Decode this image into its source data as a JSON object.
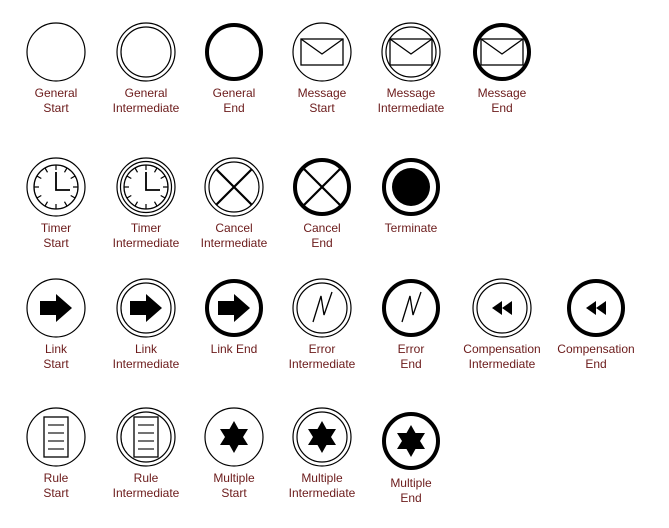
{
  "palette": {
    "stroke": "#000000",
    "label": "#6b1a1a",
    "background": "#ffffff"
  },
  "rows": [
    {
      "items": [
        {
          "id": "general-start",
          "icon": "general-start-event-icon",
          "lines": [
            "General",
            "Start"
          ]
        },
        {
          "id": "general-intermediate",
          "icon": "general-intermediate-event-icon",
          "lines": [
            "General",
            "Intermediate"
          ]
        },
        {
          "id": "general-end",
          "icon": "general-end-event-icon",
          "lines": [
            "General",
            "End"
          ]
        },
        {
          "id": "message-start",
          "icon": "message-start-event-icon",
          "lines": [
            "Message",
            "Start"
          ]
        },
        {
          "id": "message-intermediate",
          "icon": "message-intermediate-event-icon",
          "lines": [
            "Message",
            "Intermediate"
          ]
        },
        {
          "id": "message-end",
          "icon": "message-end-event-icon",
          "lines": [
            "Message",
            "End"
          ]
        }
      ]
    },
    {
      "items": [
        {
          "id": "timer-start",
          "icon": "timer-start-event-icon",
          "lines": [
            "Timer",
            "Start"
          ]
        },
        {
          "id": "timer-intermediate",
          "icon": "timer-intermediate-event-icon",
          "lines": [
            "Timer",
            "Intermediate"
          ]
        },
        {
          "id": "cancel-intermediate",
          "icon": "cancel-intermediate-event-icon",
          "lines": [
            "Cancel",
            "Intermediate"
          ]
        },
        {
          "id": "cancel-end",
          "icon": "cancel-end-event-icon",
          "lines": [
            "Cancel",
            "End"
          ]
        },
        {
          "id": "terminate",
          "icon": "terminate-event-icon",
          "lines": [
            "Terminate"
          ]
        }
      ]
    },
    {
      "items": [
        {
          "id": "link-start",
          "icon": "link-start-event-icon",
          "lines": [
            "Link",
            "Start"
          ]
        },
        {
          "id": "link-intermediate",
          "icon": "link-intermediate-event-icon",
          "lines": [
            "Link",
            "Intermediate"
          ]
        },
        {
          "id": "link-end",
          "icon": "link-end-event-icon",
          "lines": [
            "Link End"
          ]
        },
        {
          "id": "error-intermediate",
          "icon": "error-intermediate-event-icon",
          "lines": [
            "Error",
            "Intermediate"
          ]
        },
        {
          "id": "error-end",
          "icon": "error-end-event-icon",
          "lines": [
            "Error",
            "End"
          ]
        },
        {
          "id": "compensation-intermediate",
          "icon": "compensation-intermediate-event-icon",
          "lines": [
            "Compensation",
            "Intermediate"
          ]
        },
        {
          "id": "compensation-end",
          "icon": "compensation-end-event-icon",
          "lines": [
            "Compensation",
            "End"
          ]
        }
      ]
    },
    {
      "items": [
        {
          "id": "rule-start",
          "icon": "rule-start-event-icon",
          "lines": [
            "Rule",
            "Start"
          ]
        },
        {
          "id": "rule-intermediate",
          "icon": "rule-intermediate-event-icon",
          "lines": [
            "Rule",
            "Intermediate"
          ]
        },
        {
          "id": "multiple-start",
          "icon": "multiple-start-event-icon",
          "lines": [
            "Multiple",
            "Start"
          ]
        },
        {
          "id": "multiple-intermediate",
          "icon": "multiple-intermediate-event-icon",
          "lines": [
            "Multiple",
            "Intermediate"
          ]
        },
        {
          "id": "multiple-end",
          "icon": "multiple-end-event-icon",
          "lines": [
            "Multiple",
            "End"
          ]
        }
      ]
    }
  ]
}
